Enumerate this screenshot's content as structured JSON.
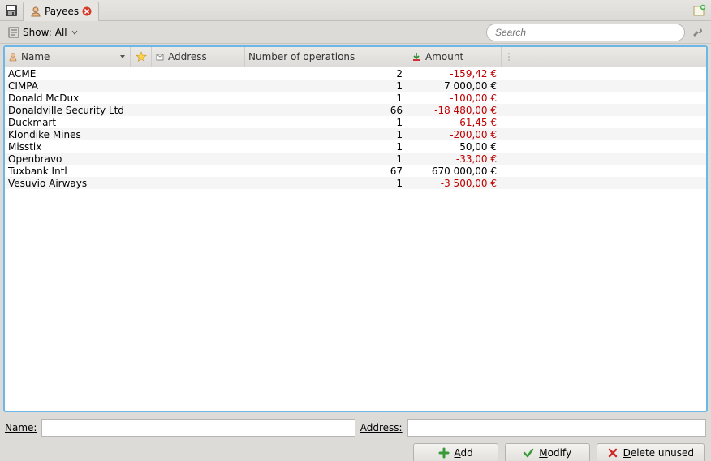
{
  "toolbar": {
    "tab_label": "Payees"
  },
  "filter": {
    "show_label": "Show:",
    "show_value": "All",
    "search_placeholder": "Search"
  },
  "columns": {
    "name": "Name",
    "address": "Address",
    "ops": "Number of operations",
    "amount": "Amount"
  },
  "rows": [
    {
      "name": "ACME",
      "address": "",
      "ops": "2",
      "amount": "-159,42 €",
      "negative": true
    },
    {
      "name": "CIMPA",
      "address": "",
      "ops": "1",
      "amount": "7 000,00 €",
      "negative": false
    },
    {
      "name": "Donald McDux",
      "address": "",
      "ops": "1",
      "amount": "-100,00 €",
      "negative": true
    },
    {
      "name": "Donaldville Security Ltd",
      "address": "",
      "ops": "66",
      "amount": "-18 480,00 €",
      "negative": true
    },
    {
      "name": "Duckmart",
      "address": "",
      "ops": "1",
      "amount": "-61,45 €",
      "negative": true
    },
    {
      "name": "Klondike Mines",
      "address": "",
      "ops": "1",
      "amount": "-200,00 €",
      "negative": true
    },
    {
      "name": "Misstix",
      "address": "",
      "ops": "1",
      "amount": "50,00 €",
      "negative": false
    },
    {
      "name": "Openbravo",
      "address": "",
      "ops": "1",
      "amount": "-33,00 €",
      "negative": true
    },
    {
      "name": "Tuxbank Intl",
      "address": "",
      "ops": "67",
      "amount": "670 000,00 €",
      "negative": false
    },
    {
      "name": "Vesuvio Airways",
      "address": "",
      "ops": "1",
      "amount": "-3 500,00 €",
      "negative": true
    }
  ],
  "edit": {
    "name_label": "Name:",
    "name_value": "",
    "address_label": "Address:",
    "address_value": ""
  },
  "buttons": {
    "add": "Add",
    "modify": "Modify",
    "delete": "Delete unused"
  }
}
